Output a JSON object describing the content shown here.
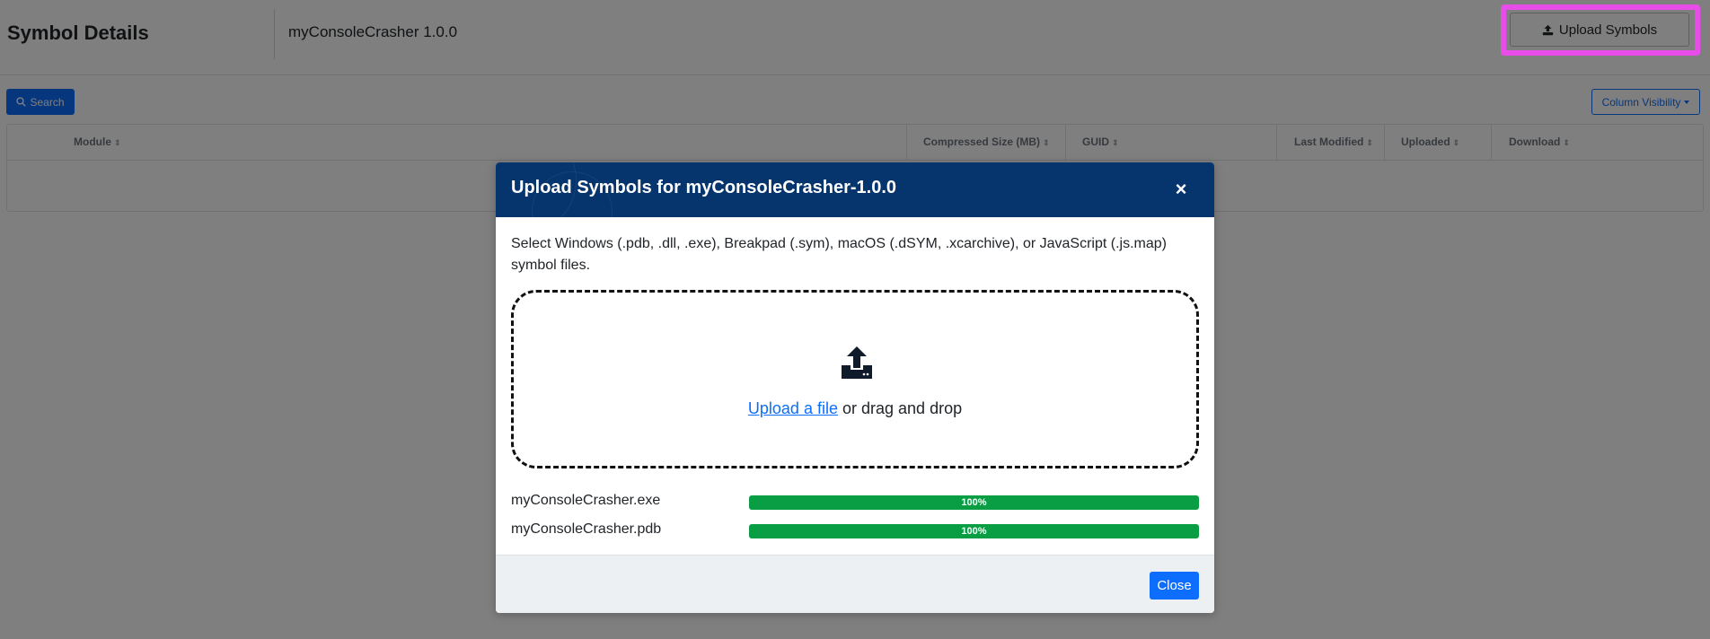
{
  "header": {
    "page_title": "Symbol Details",
    "app_version": "myConsoleCrasher 1.0.0",
    "upload_button_label": "Upload Symbols"
  },
  "toolbar": {
    "search_label": "Search",
    "column_visibility_label": "Column Visibility"
  },
  "table": {
    "columns": [
      "Module",
      "Compressed Size (MB)",
      "GUID",
      "Last Modified",
      "Uploaded",
      "Download"
    ]
  },
  "modal": {
    "title": "Upload Symbols for myConsoleCrasher-1.0.0",
    "close_icon": "close-icon",
    "description": "Select Windows (.pdb, .dll, .exe), Breakpad (.sym), macOS (.dSYM, .xcarchive), or JavaScript (.js.map) symbol files.",
    "dropzone": {
      "icon": "upload-icon",
      "link_label": "Upload a file",
      "suffix": "or drag and drop"
    },
    "files": [
      {
        "name": "myConsoleCrasher.exe",
        "progress": 100,
        "progress_label": "100%"
      },
      {
        "name": "myConsoleCrasher.pdb",
        "progress": 100,
        "progress_label": "100%"
      }
    ],
    "close_button_label": "Close"
  },
  "colors": {
    "primary": "#0d6efd",
    "modal_header": "#06356e",
    "progress": "#0a9e44",
    "highlight": "#e84dea"
  }
}
